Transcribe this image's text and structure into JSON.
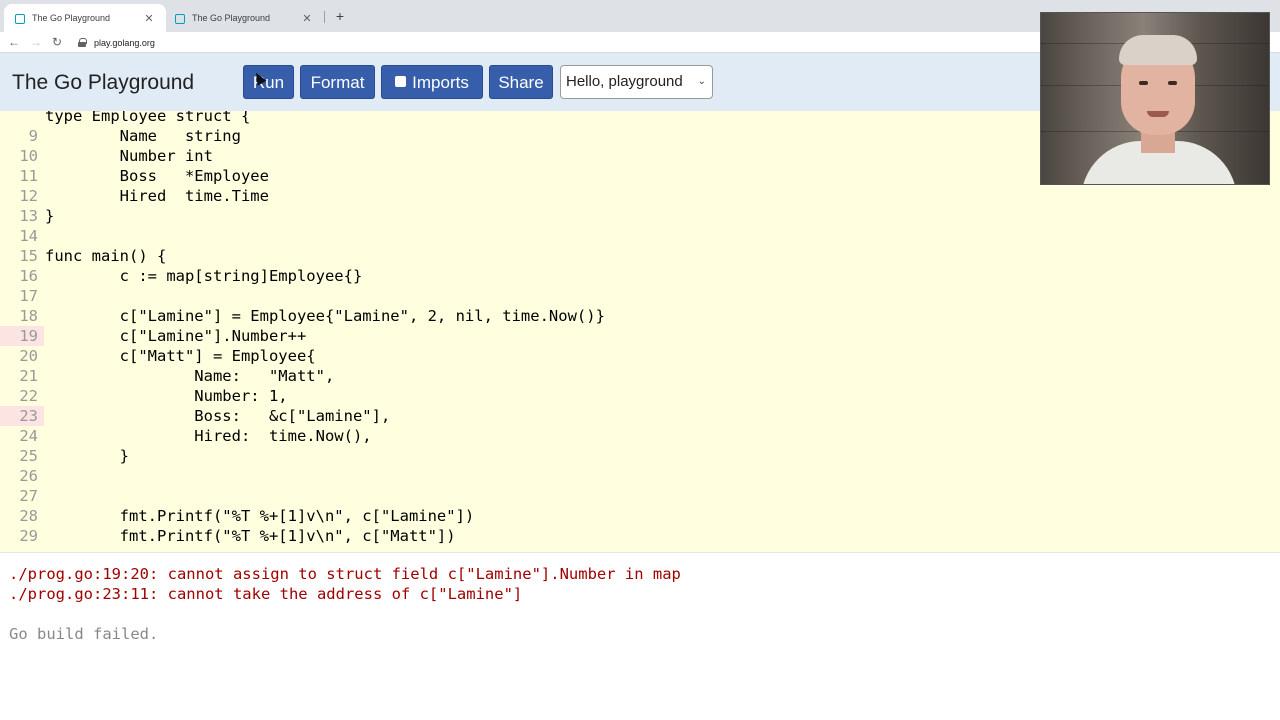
{
  "browser": {
    "tabs": [
      {
        "title": "The Go Playground",
        "active": true
      },
      {
        "title": "The Go Playground",
        "active": false
      }
    ],
    "new_tab": "+",
    "close_glyph": "✕",
    "back": "←",
    "forward": "→",
    "reload": "↻",
    "url": "play.golang.org"
  },
  "header": {
    "title": "The Go Playground",
    "buttons": {
      "run": "Run",
      "format": "Format",
      "imports": "Imports",
      "share": "Share"
    },
    "example_select": "Hello, playground",
    "chevron": "⌄"
  },
  "editor": {
    "lines": [
      {
        "num": "",
        "code": "type Employee struct {",
        "error": false
      },
      {
        "num": "9",
        "code": "        Name   string",
        "error": false
      },
      {
        "num": "10",
        "code": "        Number int",
        "error": false
      },
      {
        "num": "11",
        "code": "        Boss   *Employee",
        "error": false
      },
      {
        "num": "12",
        "code": "        Hired  time.Time",
        "error": false
      },
      {
        "num": "13",
        "code": "}",
        "error": false
      },
      {
        "num": "14",
        "code": "",
        "error": false
      },
      {
        "num": "15",
        "code": "func main() {",
        "error": false
      },
      {
        "num": "16",
        "code": "        c := map[string]Employee{}",
        "error": false
      },
      {
        "num": "17",
        "code": "",
        "error": false
      },
      {
        "num": "18",
        "code": "        c[\"Lamine\"] = Employee{\"Lamine\", 2, nil, time.Now()}",
        "error": false
      },
      {
        "num": "19",
        "code": "        c[\"Lamine\"].Number++",
        "error": true
      },
      {
        "num": "20",
        "code": "        c[\"Matt\"] = Employee{",
        "error": false
      },
      {
        "num": "21",
        "code": "                Name:   \"Matt\",",
        "error": false
      },
      {
        "num": "22",
        "code": "                Number: 1,",
        "error": false
      },
      {
        "num": "23",
        "code": "                Boss:   &c[\"Lamine\"],",
        "error": true
      },
      {
        "num": "24",
        "code": "                Hired:  time.Now(),",
        "error": false
      },
      {
        "num": "25",
        "code": "        }",
        "error": false
      },
      {
        "num": "26",
        "code": "",
        "error": false
      },
      {
        "num": "27",
        "code": "",
        "error": false
      },
      {
        "num": "28",
        "code": "        fmt.Printf(\"%T %+[1]v\\n\", c[\"Lamine\"])",
        "error": false
      },
      {
        "num": "29",
        "code": "        fmt.Printf(\"%T %+[1]v\\n\", c[\"Matt\"])",
        "error": false
      }
    ]
  },
  "output": {
    "errors": [
      "./prog.go:19:20: cannot assign to struct field c[\"Lamine\"].Number in map",
      "./prog.go:23:11: cannot take the address of c[\"Lamine\"]"
    ],
    "status": "Go build failed."
  },
  "colors": {
    "header_bg": "#e0ebf5",
    "button_bg": "#375eab",
    "editor_bg": "#ffffe0",
    "error_text": "#a00000",
    "error_gutter": "#fde4e4"
  }
}
